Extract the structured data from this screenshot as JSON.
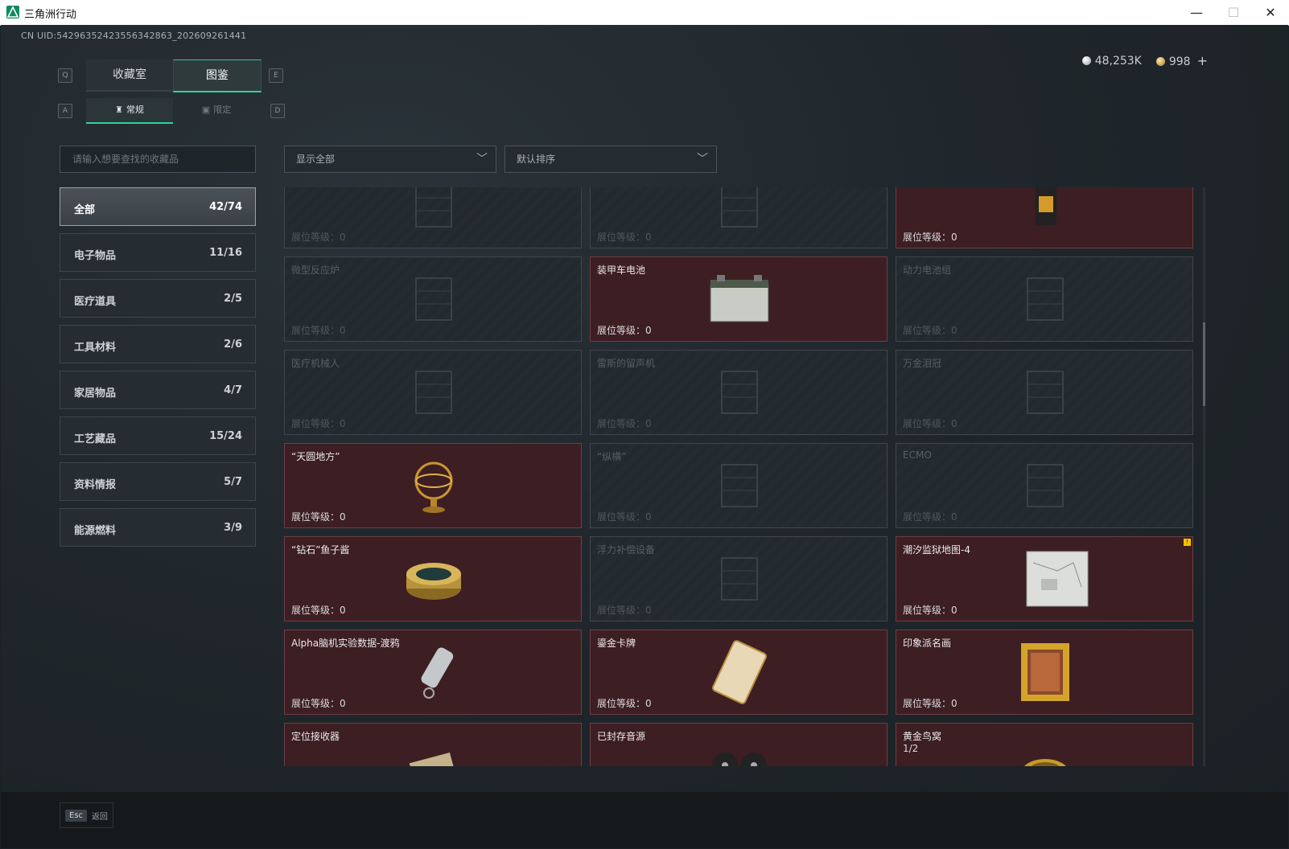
{
  "window": {
    "title": "三角洲行动",
    "min_icon": "minimize-icon",
    "max_icon": "maximize-icon",
    "close_icon": "close-icon"
  },
  "uid_text": "CN UID:5429635242355634286​3_202609261441",
  "currency": {
    "silver": "48,253K",
    "gold": "998",
    "plus": "+"
  },
  "main_tabs": {
    "key_left": "Q",
    "key_right": "E",
    "tabs": [
      "收藏室",
      "图鉴"
    ],
    "active": 1
  },
  "sub_tabs": {
    "key_left": "A",
    "key_right": "D",
    "tabs": [
      "常规",
      "限定"
    ],
    "active": 0
  },
  "search": {
    "placeholder": "请输入想要查找的收藏品"
  },
  "filters": {
    "display": "显示全部",
    "sort": "默认排序"
  },
  "categories": [
    {
      "label": "全部",
      "count": "42/74",
      "active": true
    },
    {
      "label": "电子物品",
      "count": "11/16"
    },
    {
      "label": "医疗道具",
      "count": "2/5"
    },
    {
      "label": "工具材料",
      "count": "2/6"
    },
    {
      "label": "家居物品",
      "count": "4/7"
    },
    {
      "label": "工艺藏品",
      "count": "15/24"
    },
    {
      "label": "资料情报",
      "count": "5/7"
    },
    {
      "label": "能源燃料",
      "count": "3/9"
    }
  ],
  "level_label": "展位等级：",
  "cards": [
    {
      "name": "",
      "level": "0",
      "owned": false,
      "icon": "crate-icon"
    },
    {
      "name": "",
      "level": "0",
      "owned": false,
      "icon": "device-icon"
    },
    {
      "name": "",
      "level": "0",
      "owned": true,
      "icon": "coffee-bag-icon"
    },
    {
      "name": "微型反应炉",
      "level": "0",
      "owned": false,
      "icon": "reactor-icon"
    },
    {
      "name": "装甲车电池",
      "level": "0",
      "owned": true,
      "icon": "battery-icon"
    },
    {
      "name": "动力电池组",
      "level": "0",
      "owned": false,
      "icon": "battery-pack-icon"
    },
    {
      "name": "医疗机械人",
      "level": "0",
      "owned": false,
      "icon": "robot-icon"
    },
    {
      "name": "雷斯的留声机",
      "level": "0",
      "owned": false,
      "icon": "gramophone-icon"
    },
    {
      "name": "万金泪冠",
      "level": "0",
      "owned": false,
      "icon": "crown-icon"
    },
    {
      "name": "“天圆地方”",
      "level": "0",
      "owned": true,
      "icon": "armillary-sphere-icon"
    },
    {
      "name": "“纵横”",
      "level": "0",
      "owned": false,
      "icon": "board-icon"
    },
    {
      "name": "ECMO",
      "level": "0",
      "owned": false,
      "icon": "ecmo-icon"
    },
    {
      "name": "“钻石”鱼子酱",
      "level": "0",
      "owned": true,
      "icon": "caviar-tin-icon"
    },
    {
      "name": "浮力补偿设备",
      "level": "0",
      "owned": false,
      "icon": "vest-icon"
    },
    {
      "name": "潮汐监狱地图-4",
      "level": "0",
      "owned": true,
      "icon": "map-icon",
      "badge": "!"
    },
    {
      "name": "Alpha脑机实验数据-渡鸦",
      "level": "0",
      "owned": true,
      "icon": "data-canister-icon"
    },
    {
      "name": "鎏金卡牌",
      "level": "0",
      "owned": true,
      "icon": "card-icon"
    },
    {
      "name": "印象派名画",
      "level": "0",
      "owned": true,
      "icon": "painting-icon"
    },
    {
      "name": "定位接收器",
      "level": "",
      "owned": true,
      "icon": "receiver-icon"
    },
    {
      "name": "已封存音源",
      "level": "",
      "owned": true,
      "icon": "reel-icon"
    },
    {
      "name": "黄金鸟窝",
      "level": "",
      "owned": true,
      "icon": "nest-icon",
      "sub": "1/2"
    }
  ],
  "bottom": {
    "esc_key": "Esc",
    "esc_label": "返回"
  },
  "colors": {
    "accent": "#2fd39a",
    "owned_card": "#3d1e23",
    "background": "#1b2126"
  }
}
